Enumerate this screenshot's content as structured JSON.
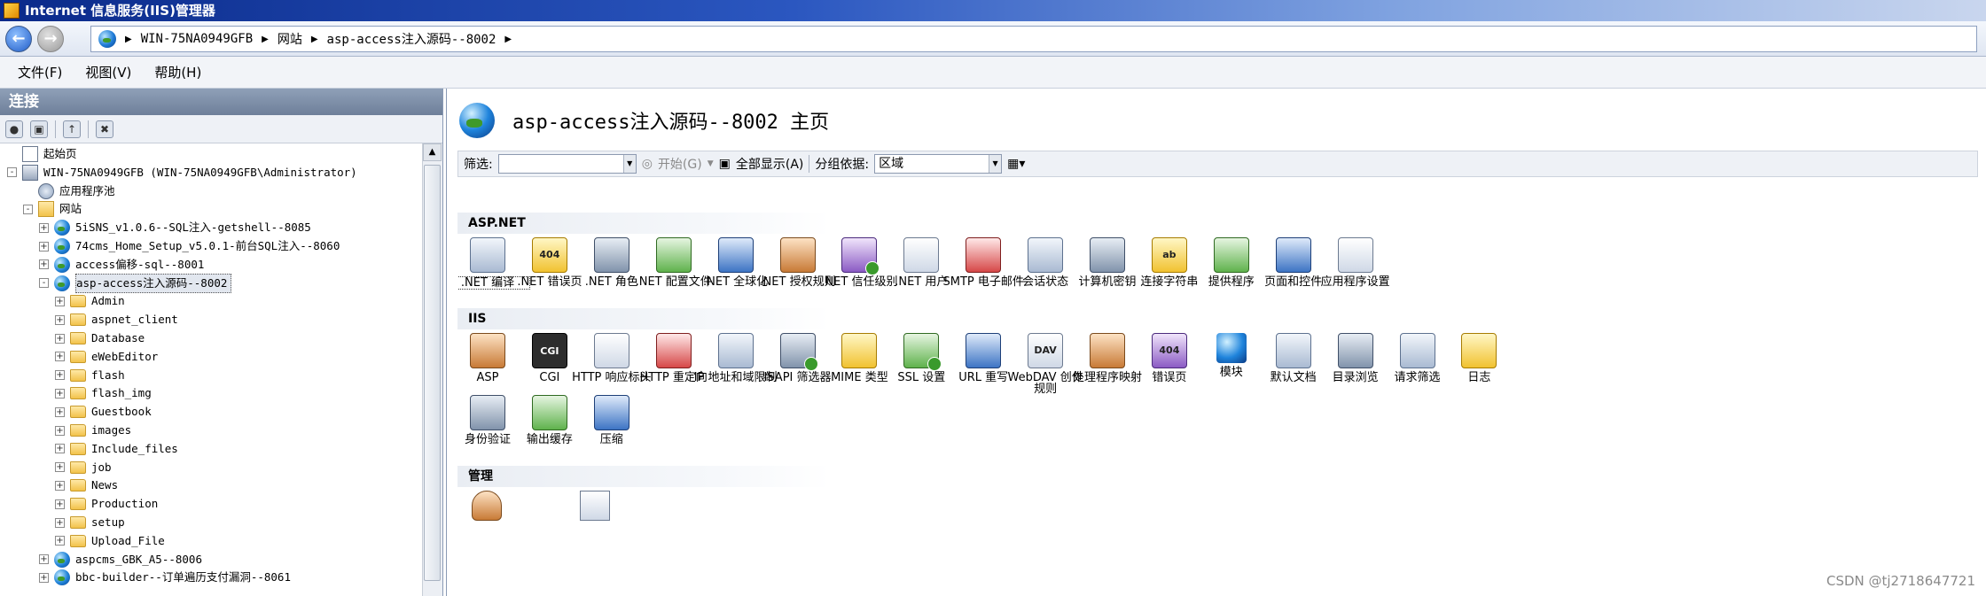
{
  "window": {
    "title": "Internet 信息服务(IIS)管理器"
  },
  "address": {
    "crumbs": [
      "WIN-75NA0949GFB",
      "网站",
      "asp-access注入源码--8002"
    ]
  },
  "menu": [
    "文件(F)",
    "视图(V)",
    "帮助(H)"
  ],
  "connections": {
    "header": "连接",
    "tree": [
      {
        "label": "起始页",
        "level": 0,
        "icon": "start-page-icon",
        "expander": ""
      },
      {
        "label": "WIN-75NA0949GFB (WIN-75NA0949GFB\\Administrator)",
        "level": 0,
        "icon": "server-icon",
        "expander": "-"
      },
      {
        "label": "应用程序池",
        "level": 1,
        "icon": "app-pool-icon",
        "expander": ""
      },
      {
        "label": "网站",
        "level": 1,
        "icon": "sites-folder-icon",
        "expander": "-"
      },
      {
        "label": "5iSNS_v1.0.6--SQL注入-getshell--8085",
        "level": 2,
        "icon": "globe-icon",
        "expander": "+"
      },
      {
        "label": "74cms_Home_Setup_v5.0.1-前台SQL注入--8060",
        "level": 2,
        "icon": "globe-icon",
        "expander": "+"
      },
      {
        "label": "access偏移-sql--8001",
        "level": 2,
        "icon": "globe-icon",
        "expander": "+"
      },
      {
        "label": "asp-access注入源码--8002",
        "level": 2,
        "icon": "globe-icon",
        "expander": "-",
        "selected": true
      },
      {
        "label": "Admin",
        "level": 3,
        "icon": "folder-icon",
        "expander": "+"
      },
      {
        "label": "aspnet_client",
        "level": 3,
        "icon": "folder-icon",
        "expander": "+"
      },
      {
        "label": "Database",
        "level": 3,
        "icon": "folder-icon",
        "expander": "+"
      },
      {
        "label": "eWebEditor",
        "level": 3,
        "icon": "folder-icon",
        "expander": "+"
      },
      {
        "label": "flash",
        "level": 3,
        "icon": "folder-icon",
        "expander": "+"
      },
      {
        "label": "flash_img",
        "level": 3,
        "icon": "folder-icon",
        "expander": "+"
      },
      {
        "label": "Guestbook",
        "level": 3,
        "icon": "folder-icon",
        "expander": "+"
      },
      {
        "label": "images",
        "level": 3,
        "icon": "folder-icon",
        "expander": "+"
      },
      {
        "label": "Include_files",
        "level": 3,
        "icon": "folder-icon",
        "expander": "+"
      },
      {
        "label": "job",
        "level": 3,
        "icon": "folder-icon",
        "expander": "+"
      },
      {
        "label": "News",
        "level": 3,
        "icon": "folder-icon",
        "expander": "+"
      },
      {
        "label": "Production",
        "level": 3,
        "icon": "folder-icon",
        "expander": "+"
      },
      {
        "label": "setup",
        "level": 3,
        "icon": "folder-icon",
        "expander": "+"
      },
      {
        "label": "Upload_File",
        "level": 3,
        "icon": "folder-icon",
        "expander": "+"
      },
      {
        "label": "aspcms_GBK_A5--8006",
        "level": 2,
        "icon": "globe-icon",
        "expander": "+"
      },
      {
        "label": "bbc-builder--订单遍历支付漏洞--8061",
        "level": 2,
        "icon": "globe-icon",
        "expander": "+"
      }
    ]
  },
  "main": {
    "title": "asp-access注入源码--8002 主页",
    "filter": {
      "label": "筛选:",
      "start": "开始(G)",
      "show_all": "全部显示(A)",
      "group_by_label": "分组依据:",
      "group_by_value": "区域"
    },
    "groups": [
      {
        "name": "ASP.NET",
        "features": [
          {
            "label": ".NET 编译",
            "icon": "dotnet-compile-icon"
          },
          {
            "label": ".NET 错误页",
            "icon": "dotnet-error-pages-icon",
            "glyph": "404"
          },
          {
            "label": ".NET 角色",
            "icon": "dotnet-roles-icon"
          },
          {
            "label": ".NET 配置文件",
            "icon": "dotnet-profile-icon"
          },
          {
            "label": ".NET 全球化",
            "icon": "dotnet-globalization-icon"
          },
          {
            "label": ".NET 授权规则",
            "icon": "dotnet-authorization-icon"
          },
          {
            "label": ".NET 信任级别",
            "icon": "dotnet-trust-levels-icon"
          },
          {
            "label": ".NET 用户",
            "icon": "dotnet-users-icon"
          },
          {
            "label": "SMTP 电子邮件",
            "icon": "smtp-email-icon"
          },
          {
            "label": "会话状态",
            "icon": "session-state-icon"
          },
          {
            "label": "计算机密钥",
            "icon": "machine-key-icon"
          },
          {
            "label": "连接字符串",
            "icon": "connection-strings-icon",
            "glyph": "ab"
          },
          {
            "label": "提供程序",
            "icon": "providers-icon"
          },
          {
            "label": "页面和控件",
            "icon": "pages-controls-icon"
          },
          {
            "label": "应用程序设置",
            "icon": "app-settings-icon"
          }
        ]
      },
      {
        "name": "IIS",
        "features": [
          {
            "label": "ASP",
            "icon": "asp-icon"
          },
          {
            "label": "CGI",
            "icon": "cgi-icon",
            "glyph": "CGI"
          },
          {
            "label": "HTTP 响应标头",
            "icon": "http-response-headers-icon"
          },
          {
            "label": "HTTP 重定向",
            "icon": "http-redirect-icon"
          },
          {
            "label": "IP 地址和域限制",
            "icon": "ip-domain-restrictions-icon"
          },
          {
            "label": "ISAPI 筛选器",
            "icon": "isapi-filters-icon"
          },
          {
            "label": "MIME 类型",
            "icon": "mime-types-icon"
          },
          {
            "label": "SSL 设置",
            "icon": "ssl-settings-icon"
          },
          {
            "label": "URL 重写",
            "icon": "url-rewrite-icon"
          },
          {
            "label": "WebDAV 创作规则",
            "icon": "webdav-icon",
            "glyph": "DAV"
          },
          {
            "label": "处理程序映射",
            "icon": "handler-mappings-icon"
          },
          {
            "label": "错误页",
            "icon": "error-pages-icon",
            "glyph": "404"
          },
          {
            "label": "模块",
            "icon": "modules-icon"
          },
          {
            "label": "默认文档",
            "icon": "default-document-icon"
          },
          {
            "label": "目录浏览",
            "icon": "directory-browsing-icon"
          },
          {
            "label": "请求筛选",
            "icon": "request-filtering-icon"
          },
          {
            "label": "日志",
            "icon": "logging-icon"
          },
          {
            "label": "身份验证",
            "icon": "authentication-icon"
          },
          {
            "label": "输出缓存",
            "icon": "output-caching-icon"
          },
          {
            "label": "压缩",
            "icon": "compression-icon"
          }
        ]
      },
      {
        "name": "管理",
        "features": []
      }
    ]
  },
  "watermark": "CSDN @tj2718647721"
}
